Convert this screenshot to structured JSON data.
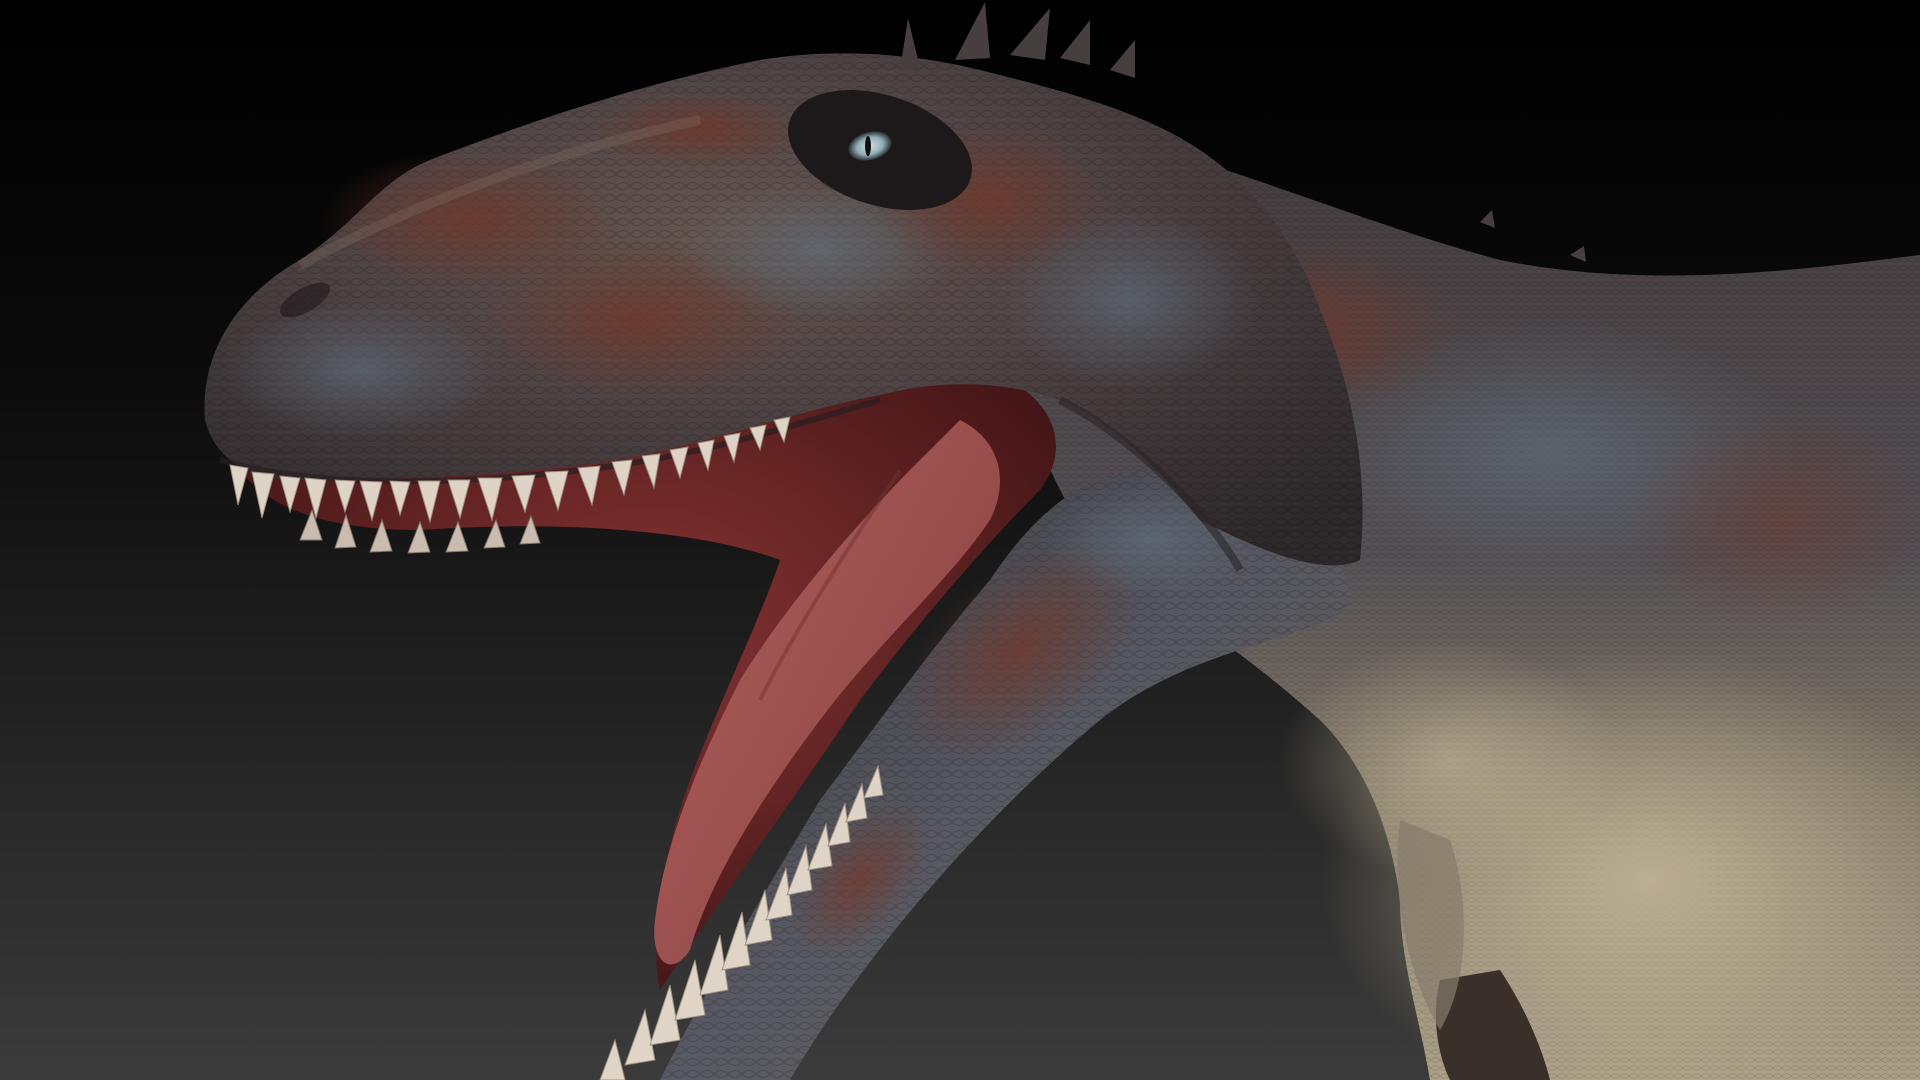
{
  "scene": {
    "subject": "dinosaur-head-render",
    "background": {
      "top": "#000000",
      "bottom": "#3a3a3a"
    },
    "skin_colors": {
      "dorsal": "#4f4642",
      "mottle_red": "#6e3a2e",
      "mottle_blue": "#56606a",
      "belly": "#b3a58a",
      "mouth_interior": "#7a2a2a",
      "tongue": "#b05a58",
      "teeth": "#f1e4d6",
      "eye": "#b9d3dc"
    }
  }
}
